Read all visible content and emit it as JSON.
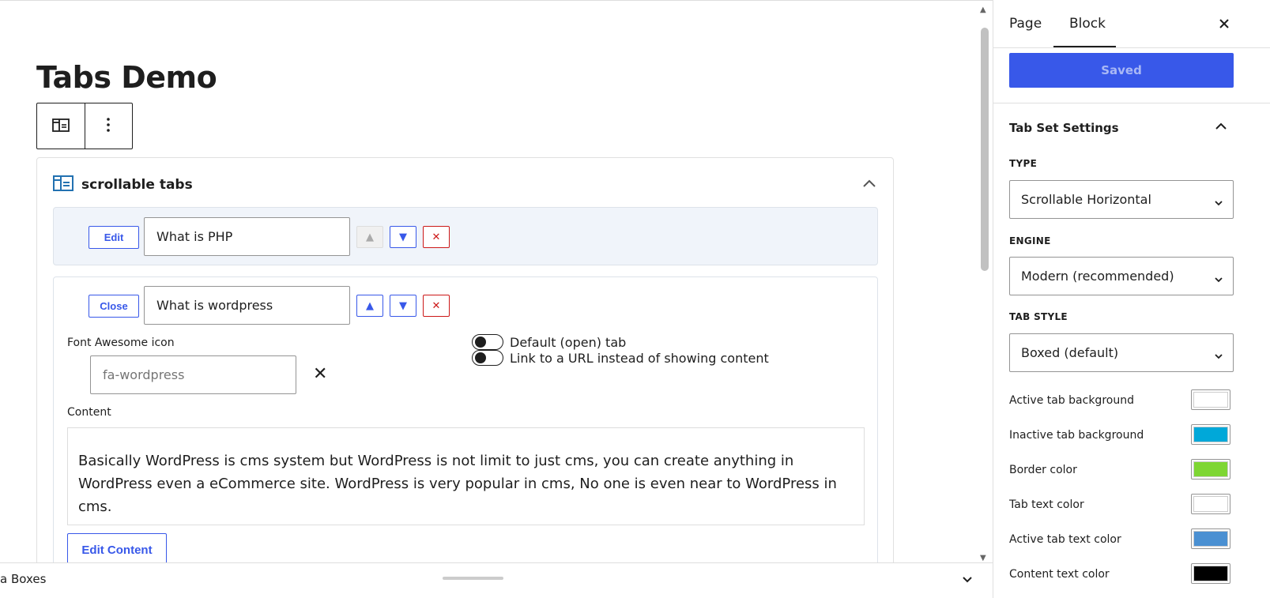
{
  "page": {
    "title": "Tabs Demo"
  },
  "block": {
    "label": "scrollable tabs",
    "tabs": [
      {
        "button": "Edit",
        "title": "What is PHP"
      },
      {
        "button": "Close",
        "title": "What is wordpress"
      }
    ],
    "up_symbol": "▲",
    "down_symbol": "▼",
    "remove_symbol": "✕",
    "editor": {
      "icon_label": "Font Awesome icon",
      "icon_placeholder": "fa-wordpress",
      "clear_symbol": "✕",
      "default_tab_label": "Default (open) tab",
      "link_label": "Link to a URL instead of showing content",
      "content_label": "Content",
      "content_text": "Basically WordPress is cms system but WordPress is not limit to just cms, you can create anything in WordPress even a eCommerce site. WordPress is very popular in cms, No one is even near to WordPress in cms.",
      "edit_content_label": "Edit Content"
    }
  },
  "meta_bar": {
    "label": "a Boxes"
  },
  "sidebar": {
    "tabs": {
      "page": "Page",
      "block": "Block"
    },
    "saved_label": "Saved",
    "panel_title": "Tab Set Settings",
    "type_label": "TYPE",
    "type_value": "Scrollable Horizontal",
    "engine_label": "ENGINE",
    "engine_value": "Modern (recommended)",
    "style_label": "TAB STYLE",
    "style_value": "Boxed (default)",
    "colors": [
      {
        "label": "Active tab background",
        "color": "#ffffff"
      },
      {
        "label": "Inactive tab background",
        "color": "#00a8d9"
      },
      {
        "label": "Border color",
        "color": "#7ed633"
      },
      {
        "label": "Tab text color",
        "color": "#ffffff"
      },
      {
        "label": "Active tab text color",
        "color": "#4a90d2"
      },
      {
        "label": "Content text color",
        "color": "#000000"
      }
    ]
  },
  "theme": {
    "accent": "#3858e9",
    "danger": "#cc1818",
    "block_icon": "#2271b1"
  }
}
